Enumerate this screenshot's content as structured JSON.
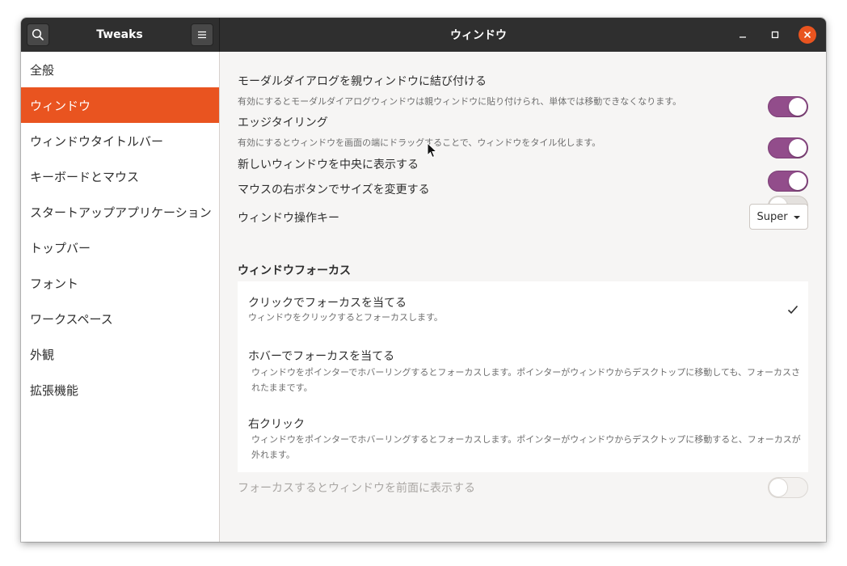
{
  "app_title": "Tweaks",
  "window_title": "ウィンドウ",
  "sidebar": {
    "items": [
      {
        "label": "全般"
      },
      {
        "label": "ウィンドウ"
      },
      {
        "label": "ウィンドウタイトルバー"
      },
      {
        "label": "キーボードとマウス"
      },
      {
        "label": "スタートアップアプリケーション"
      },
      {
        "label": "トップバー"
      },
      {
        "label": "フォント"
      },
      {
        "label": "ワークスペース"
      },
      {
        "label": "外観"
      },
      {
        "label": "拡張機能"
      }
    ],
    "active_index": 1
  },
  "settings": {
    "attach_modal": {
      "title": "モーダルダイアログを親ウィンドウに結び付ける",
      "desc": "有効にするとモーダルダイアログウィンドウは親ウィンドウに貼り付けられ、単体では移動できなくなります。",
      "enabled": true
    },
    "edge_tiling": {
      "title": "エッジタイリング",
      "desc": "有効にするとウィンドウを画面の端にドラッグすることで、ウィンドウをタイル化します。",
      "enabled": true
    },
    "center_new": {
      "title": "新しいウィンドウを中央に表示する",
      "enabled": true
    },
    "resize_right": {
      "title": "マウスの右ボタンでサイズを変更する",
      "enabled": false
    },
    "action_key": {
      "title": "ウィンドウ操作キー",
      "value": "Super"
    }
  },
  "focus": {
    "section_title": "ウィンドウフォーカス",
    "options": [
      {
        "title": "クリックでフォーカスを当てる",
        "desc": "ウィンドウをクリックするとフォーカスします。",
        "selected": true
      },
      {
        "title": "ホバーでフォーカスを当てる",
        "desc": "ウィンドウをポインターでホバーリングするとフォーカスします。ポインターがウィンドウからデスクトップに移動しても、フォーカスされたままです。",
        "selected": false
      },
      {
        "title": "右クリック",
        "desc": "ウィンドウをポインターでホバーリングするとフォーカスします。ポインターがウィンドウからデスクトップに移動すると、フォーカスが外れます。",
        "selected": false
      }
    ],
    "raise_on_focus": {
      "title": "フォーカスするとウィンドウを前面に表示する",
      "enabled": false,
      "disabled": true
    }
  },
  "colors": {
    "accent": "#e95420",
    "toggle_on": "#924d8b",
    "titlebar": "#2f2f2f",
    "close_button": "#e9541f"
  }
}
